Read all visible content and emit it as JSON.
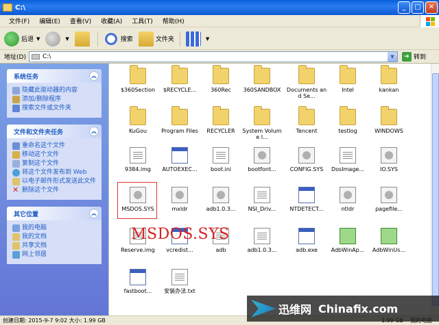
{
  "window": {
    "title": "C:\\"
  },
  "menu": [
    "文件(F)",
    "编辑(E)",
    "查看(V)",
    "收藏(A)",
    "工具(T)",
    "帮助(H)"
  ],
  "toolbar": {
    "back": "后退",
    "search": "搜索",
    "folders": "文件夹"
  },
  "address": {
    "label": "地址(D)",
    "value": "C:\\",
    "go": "转到"
  },
  "taskpane": {
    "system": {
      "title": "系统任务",
      "items": [
        "隐藏此驱动器的内容",
        "添加/删除程序",
        "搜索文件或文件夹"
      ]
    },
    "file_tasks": {
      "title": "文件和文件夹任务",
      "items": [
        "重命名这个文件",
        "移动这个文件",
        "复制这个文件",
        "将这个文件发布到 Web",
        "以电子邮件形式发送此文件",
        "删除这个文件"
      ]
    },
    "other": {
      "title": "其它位置",
      "items": [
        "我的电脑",
        "我的文档",
        "共享文档",
        "网上邻居"
      ]
    }
  },
  "files": [
    {
      "name": "$360Section",
      "icon": "folder"
    },
    {
      "name": "$RECYCLE...",
      "icon": "folder"
    },
    {
      "name": "360Rec",
      "icon": "folder"
    },
    {
      "name": "360SANDBOX",
      "icon": "folder"
    },
    {
      "name": "Documents and Se...",
      "icon": "folder"
    },
    {
      "name": "Intel",
      "icon": "folder"
    },
    {
      "name": "kankan",
      "icon": "folder"
    },
    {
      "name": "KuGou",
      "icon": "folder"
    },
    {
      "name": "Program Files",
      "icon": "folder"
    },
    {
      "name": "RECYCLER",
      "icon": "folder"
    },
    {
      "name": "System Volume I...",
      "icon": "folder"
    },
    {
      "name": "Tencent",
      "icon": "folder"
    },
    {
      "name": "testlog",
      "icon": "folder"
    },
    {
      "name": "WINDOWS",
      "icon": "folder"
    },
    {
      "name": "9384.img",
      "icon": "doc"
    },
    {
      "name": "AUTOEXEC...",
      "icon": "win"
    },
    {
      "name": "boot.ini",
      "icon": "doc"
    },
    {
      "name": "bootfont...",
      "icon": "sys"
    },
    {
      "name": "CONFIG.SYS",
      "icon": "sys"
    },
    {
      "name": "DosImage...",
      "icon": "doc"
    },
    {
      "name": "IO.SYS",
      "icon": "sys"
    },
    {
      "name": "MSDOS.SYS",
      "icon": "sys"
    },
    {
      "name": "mxldr",
      "icon": "sys"
    },
    {
      "name": "adb1.0.3...",
      "icon": "sys"
    },
    {
      "name": "NSI_Driv...",
      "icon": "doc"
    },
    {
      "name": "NTDETECT...",
      "icon": "win"
    },
    {
      "name": "ntldr",
      "icon": "sys"
    },
    {
      "name": "pagefile...",
      "icon": "sys"
    },
    {
      "name": "Reserve.img",
      "icon": "doc"
    },
    {
      "name": "vcredist...",
      "icon": "win"
    },
    {
      "name": "adb",
      "icon": "doc"
    },
    {
      "name": "adb1.0.3...",
      "icon": "doc"
    },
    {
      "name": "adb.exe",
      "icon": "win"
    },
    {
      "name": "AdbWinAp...",
      "icon": "setup"
    },
    {
      "name": "AdbWinUs...",
      "icon": "setup"
    },
    {
      "name": "fastboot...",
      "icon": "win"
    },
    {
      "name": "安装办法.txt",
      "icon": "doc"
    }
  ],
  "selected_label": "MSDOS.SYS",
  "status": {
    "left": "创建日期: 2015-9-7 9:02 大小: 1.99 GB",
    "mid": "1.99 GB",
    "right": "我的电脑"
  },
  "watermark": {
    "cn": "迅维网",
    "en": "Chinafix.com"
  },
  "colors": {
    "titlebar": "#0a5fd8",
    "taskpane_link": "#215dc6",
    "highlight_red": "#d82020"
  }
}
